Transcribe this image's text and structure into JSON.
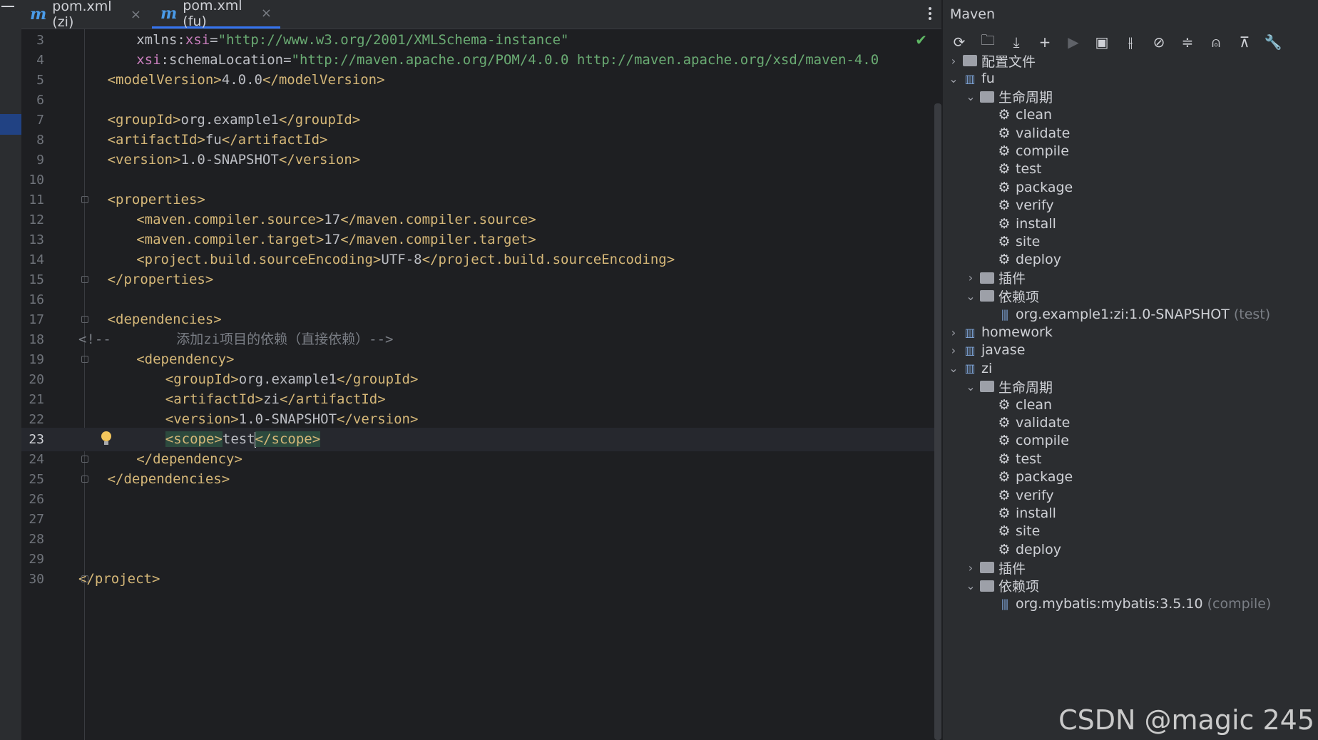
{
  "tabs": [
    {
      "icon": "m",
      "label": "pom.xml (zi)",
      "close": "×"
    },
    {
      "icon": "m",
      "label": "pom.xml (fu)",
      "close": "×"
    }
  ],
  "code_lines": [
    {
      "num": "3",
      "indent": 4,
      "segments": [
        {
          "c": "attr",
          "t": "xmlns:"
        },
        {
          "c": "ns",
          "t": "xsi"
        },
        {
          "c": "attr",
          "t": "="
        },
        {
          "c": "str",
          "t": "\"http://www.w3.org/2001/XMLSchema-instance\""
        }
      ]
    },
    {
      "num": "4",
      "indent": 4,
      "segments": [
        {
          "c": "ns",
          "t": "xsi"
        },
        {
          "c": "attr",
          "t": ":schemaLocation="
        },
        {
          "c": "str",
          "t": "\"http://maven.apache.org/POM/4.0.0 http://maven.apache.org/xsd/maven-4.0"
        }
      ]
    },
    {
      "num": "5",
      "indent": 2,
      "segments": [
        {
          "c": "tag",
          "t": "<modelVersion>"
        },
        {
          "c": "val",
          "t": "4.0.0"
        },
        {
          "c": "tag",
          "t": "</modelVersion>"
        }
      ]
    },
    {
      "num": "6",
      "indent": 0,
      "segments": []
    },
    {
      "num": "7",
      "indent": 2,
      "segments": [
        {
          "c": "tag",
          "t": "<groupId>"
        },
        {
          "c": "val",
          "t": "org.example1"
        },
        {
          "c": "tag",
          "t": "</groupId>"
        }
      ]
    },
    {
      "num": "8",
      "indent": 2,
      "segments": [
        {
          "c": "tag",
          "t": "<artifactId>"
        },
        {
          "c": "val",
          "t": "fu"
        },
        {
          "c": "tag",
          "t": "</artifactId>"
        }
      ]
    },
    {
      "num": "9",
      "indent": 2,
      "segments": [
        {
          "c": "tag",
          "t": "<version>"
        },
        {
          "c": "val",
          "t": "1.0-SNAPSHOT"
        },
        {
          "c": "tag",
          "t": "</version>"
        }
      ]
    },
    {
      "num": "10",
      "indent": 0,
      "segments": []
    },
    {
      "num": "11",
      "indent": 2,
      "segments": [
        {
          "c": "tag",
          "t": "<properties>"
        }
      ]
    },
    {
      "num": "12",
      "indent": 4,
      "segments": [
        {
          "c": "tag",
          "t": "<maven.compiler.source>"
        },
        {
          "c": "val",
          "t": "17"
        },
        {
          "c": "tag",
          "t": "</maven.compiler.source>"
        }
      ]
    },
    {
      "num": "13",
      "indent": 4,
      "segments": [
        {
          "c": "tag",
          "t": "<maven.compiler.target>"
        },
        {
          "c": "val",
          "t": "17"
        },
        {
          "c": "tag",
          "t": "</maven.compiler.target>"
        }
      ]
    },
    {
      "num": "14",
      "indent": 4,
      "segments": [
        {
          "c": "tag",
          "t": "<project.build.sourceEncoding>"
        },
        {
          "c": "val",
          "t": "UTF-8"
        },
        {
          "c": "tag",
          "t": "</project.build.sourceEncoding>"
        }
      ]
    },
    {
      "num": "15",
      "indent": 2,
      "segments": [
        {
          "c": "tag",
          "t": "</properties>"
        }
      ]
    },
    {
      "num": "16",
      "indent": 0,
      "segments": []
    },
    {
      "num": "17",
      "indent": 2,
      "segments": [
        {
          "c": "tag",
          "t": "<dependencies>"
        }
      ]
    },
    {
      "num": "18",
      "indent": 0,
      "segments": [
        {
          "c": "cmt",
          "t": "<!--        添加zi项目的依赖（直接依赖）-->"
        }
      ]
    },
    {
      "num": "19",
      "indent": 4,
      "segments": [
        {
          "c": "tag",
          "t": "<dependency>"
        }
      ]
    },
    {
      "num": "20",
      "indent": 6,
      "segments": [
        {
          "c": "tag",
          "t": "<groupId>"
        },
        {
          "c": "val",
          "t": "org.example1"
        },
        {
          "c": "tag",
          "t": "</groupId>"
        }
      ]
    },
    {
      "num": "21",
      "indent": 6,
      "segments": [
        {
          "c": "tag",
          "t": "<artifactId>"
        },
        {
          "c": "val",
          "t": "zi"
        },
        {
          "c": "tag",
          "t": "</artifactId>"
        }
      ]
    },
    {
      "num": "22",
      "indent": 6,
      "segments": [
        {
          "c": "tag",
          "t": "<version>"
        },
        {
          "c": "val",
          "t": "1.0-SNAPSHOT"
        },
        {
          "c": "tag",
          "t": "</version>"
        }
      ]
    },
    {
      "num": "23",
      "indent": 6,
      "current": true,
      "segments": [
        {
          "c": "tag hl",
          "t": "<scope>"
        },
        {
          "c": "val",
          "t": "test"
        },
        {
          "c": "caret",
          "t": ""
        },
        {
          "c": "tag hl",
          "t": "</scope>"
        }
      ]
    },
    {
      "num": "24",
      "indent": 4,
      "segments": [
        {
          "c": "tag",
          "t": "</dependency>"
        }
      ]
    },
    {
      "num": "25",
      "indent": 2,
      "segments": [
        {
          "c": "tag",
          "t": "</dependencies>"
        }
      ]
    },
    {
      "num": "26",
      "indent": 0,
      "segments": []
    },
    {
      "num": "27",
      "indent": 0,
      "segments": []
    },
    {
      "num": "28",
      "indent": 0,
      "segments": []
    },
    {
      "num": "29",
      "indent": 0,
      "segments": []
    },
    {
      "num": "30",
      "indent": 0,
      "segments": [
        {
          "c": "tag",
          "t": "</project>"
        }
      ]
    }
  ],
  "fold_lines": [
    "11",
    "15",
    "17",
    "19",
    "24",
    "25",
    "30"
  ],
  "maven": {
    "title": "Maven",
    "toolbar": [
      "reload-icon",
      "add-folder-icon",
      "download-icon",
      "plus-icon",
      "run-icon",
      "execute-goal-icon",
      "toggle-offline-icon",
      "skip-tests-icon",
      "collapse-icon",
      "dependency-graph-icon",
      "expand-icon",
      "settings-wrench-icon"
    ],
    "tree": [
      {
        "level": 0,
        "chev": "›",
        "icon": "folder",
        "label": "配置文件"
      },
      {
        "level": 0,
        "chev": "⌄",
        "icon": "mod",
        "label": "fu"
      },
      {
        "level": 1,
        "chev": "⌄",
        "icon": "folder",
        "label": "生命周期"
      },
      {
        "level": 2,
        "chev": "",
        "icon": "gear",
        "label": "clean"
      },
      {
        "level": 2,
        "chev": "",
        "icon": "gear",
        "label": "validate"
      },
      {
        "level": 2,
        "chev": "",
        "icon": "gear",
        "label": "compile"
      },
      {
        "level": 2,
        "chev": "",
        "icon": "gear",
        "label": "test"
      },
      {
        "level": 2,
        "chev": "",
        "icon": "gear",
        "label": "package"
      },
      {
        "level": 2,
        "chev": "",
        "icon": "gear",
        "label": "verify"
      },
      {
        "level": 2,
        "chev": "",
        "icon": "gear",
        "label": "install"
      },
      {
        "level": 2,
        "chev": "",
        "icon": "gear",
        "label": "site"
      },
      {
        "level": 2,
        "chev": "",
        "icon": "gear",
        "label": "deploy"
      },
      {
        "level": 1,
        "chev": "›",
        "icon": "folder",
        "label": "插件"
      },
      {
        "level": 1,
        "chev": "⌄",
        "icon": "folder",
        "label": "依赖项"
      },
      {
        "level": 2,
        "chev": "",
        "icon": "dep",
        "label": "org.example1:zi:1.0-SNAPSHOT",
        "suffix": "(test)"
      },
      {
        "level": 0,
        "chev": "›",
        "icon": "mod",
        "label": "homework"
      },
      {
        "level": 0,
        "chev": "›",
        "icon": "mod",
        "label": "javase"
      },
      {
        "level": 0,
        "chev": "⌄",
        "icon": "mod",
        "label": "zi"
      },
      {
        "level": 1,
        "chev": "⌄",
        "icon": "folder",
        "label": "生命周期"
      },
      {
        "level": 2,
        "chev": "",
        "icon": "gear",
        "label": "clean"
      },
      {
        "level": 2,
        "chev": "",
        "icon": "gear",
        "label": "validate"
      },
      {
        "level": 2,
        "chev": "",
        "icon": "gear",
        "label": "compile"
      },
      {
        "level": 2,
        "chev": "",
        "icon": "gear",
        "label": "test"
      },
      {
        "level": 2,
        "chev": "",
        "icon": "gear",
        "label": "package"
      },
      {
        "level": 2,
        "chev": "",
        "icon": "gear",
        "label": "verify"
      },
      {
        "level": 2,
        "chev": "",
        "icon": "gear",
        "label": "install"
      },
      {
        "level": 2,
        "chev": "",
        "icon": "gear",
        "label": "site"
      },
      {
        "level": 2,
        "chev": "",
        "icon": "gear",
        "label": "deploy"
      },
      {
        "level": 1,
        "chev": "›",
        "icon": "folder",
        "label": "插件"
      },
      {
        "level": 1,
        "chev": "⌄",
        "icon": "folder",
        "label": "依赖项"
      },
      {
        "level": 2,
        "chev": "",
        "icon": "dep",
        "label": "org.mybatis:mybatis:3.5.10",
        "suffix": "(compile)"
      }
    ]
  },
  "watermark": "CSDN @magic 245"
}
